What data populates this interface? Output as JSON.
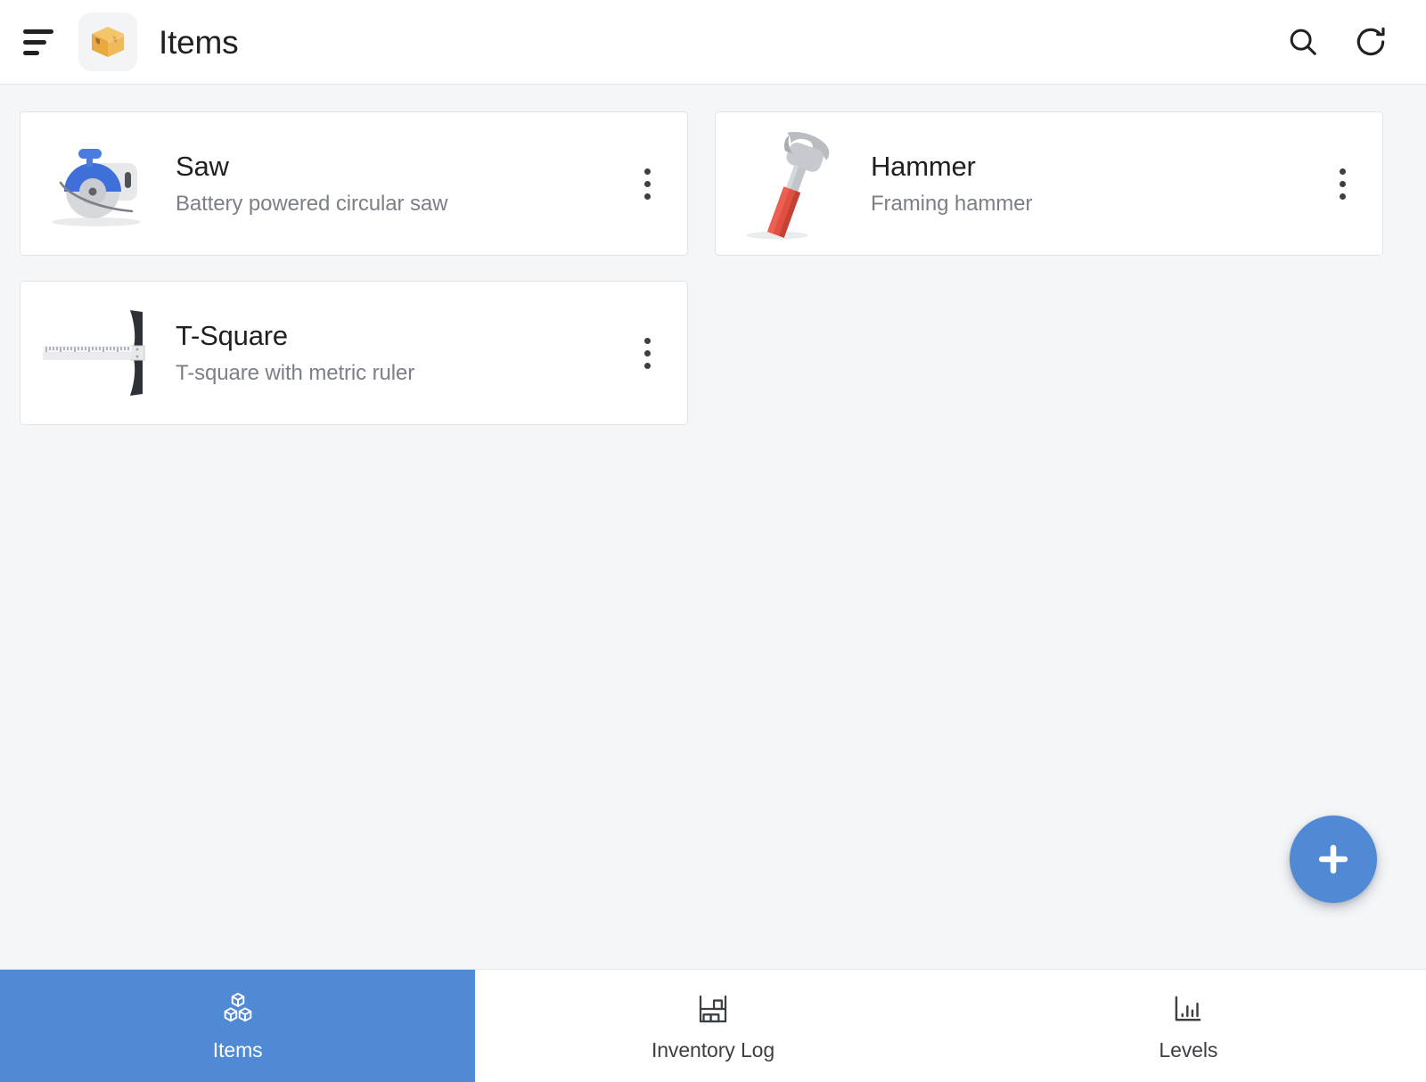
{
  "header": {
    "menu_icon": "hamburger-menu-icon",
    "app_emoji_icon": "package-box-icon",
    "title": "Items",
    "actions": [
      {
        "icon": "search-icon",
        "label": "Search"
      },
      {
        "icon": "refresh-icon",
        "label": "Refresh"
      }
    ]
  },
  "main": {
    "items": [
      {
        "name": "Saw",
        "description": "Battery powered circular saw",
        "thumb_icon": "circular-saw-icon",
        "menu_icon": "more-vertical-icon"
      },
      {
        "name": "Hammer",
        "description": "Framing hammer",
        "thumb_icon": "hammer-icon",
        "menu_icon": "more-vertical-icon"
      },
      {
        "name": "T-Square",
        "description": "T-square with metric ruler",
        "thumb_icon": "t-square-ruler-icon",
        "menu_icon": "more-vertical-icon"
      }
    ]
  },
  "fab": {
    "icon": "plus-icon",
    "label": "Add item"
  },
  "bottom_nav": {
    "active_index": 0,
    "tabs": [
      {
        "label": "Items",
        "icon": "boxes-icon"
      },
      {
        "label": "Inventory Log",
        "icon": "warehouse-shelf-icon"
      },
      {
        "label": "Levels",
        "icon": "bar-chart-icon"
      }
    ]
  },
  "colors": {
    "accent": "#5089d4",
    "page_background": "#f5f6f8",
    "card_background": "#ffffff",
    "card_border": "#e2e4e8",
    "primary_text": "#1f2023",
    "secondary_text": "#7b7f87"
  }
}
